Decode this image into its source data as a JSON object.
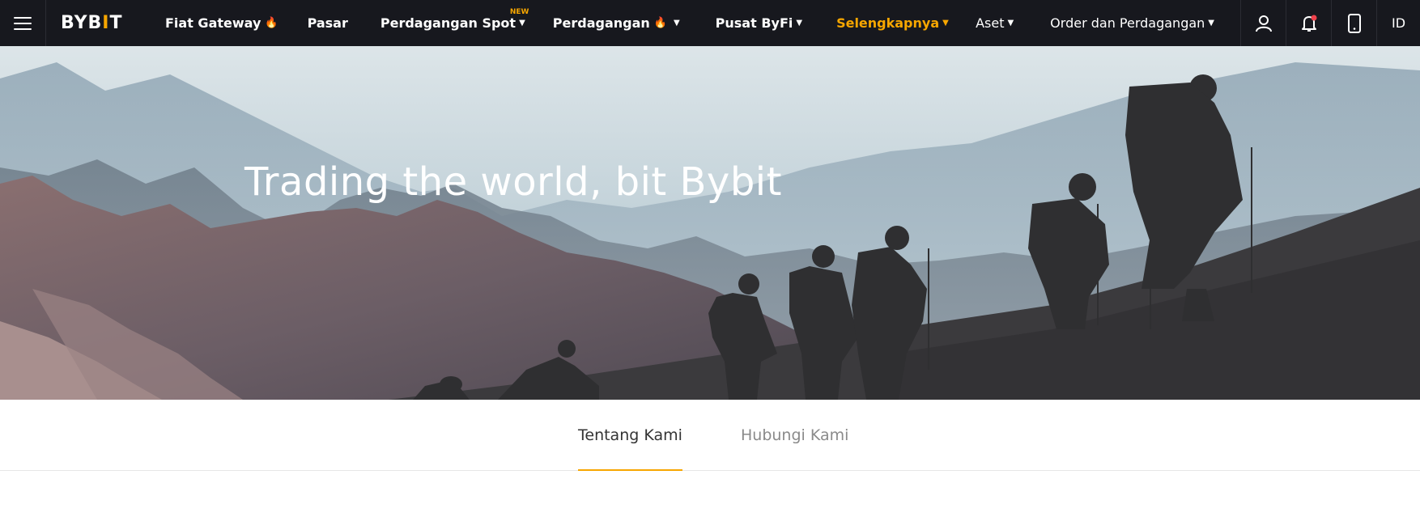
{
  "brand": {
    "logo_text_a": "BYB",
    "logo_text_i": "I",
    "logo_text_b": "T",
    "accent_color": "#f7a600"
  },
  "nav": {
    "menu_icon": "hamburger-menu-icon",
    "items": [
      {
        "label": "Fiat Gateway",
        "icon": "fire-icon"
      },
      {
        "label": "Pasar"
      },
      {
        "label": "Perdagangan Spot",
        "badge": "NEW",
        "icon": "caret-down-icon"
      },
      {
        "label": "Perdagangan",
        "icon": "fire-icon"
      },
      {
        "label": "Pusat ByFi",
        "icon": "caret-down-icon"
      },
      {
        "label": "Selengkapnya",
        "icon": "caret-down-icon"
      }
    ],
    "right": {
      "assets_label": "Aset",
      "orders_label": "Order dan Perdagangan",
      "user_icon": "user-icon",
      "bell_icon": "notification-bell-icon",
      "mobile_icon": "mobile-phone-icon",
      "language": "ID"
    }
  },
  "hero": {
    "title": "Trading the world, bit Bybit"
  },
  "tabs": [
    {
      "label": "Tentang Kami",
      "active": true
    },
    {
      "label": "Hubungi Kami",
      "active": false
    }
  ]
}
